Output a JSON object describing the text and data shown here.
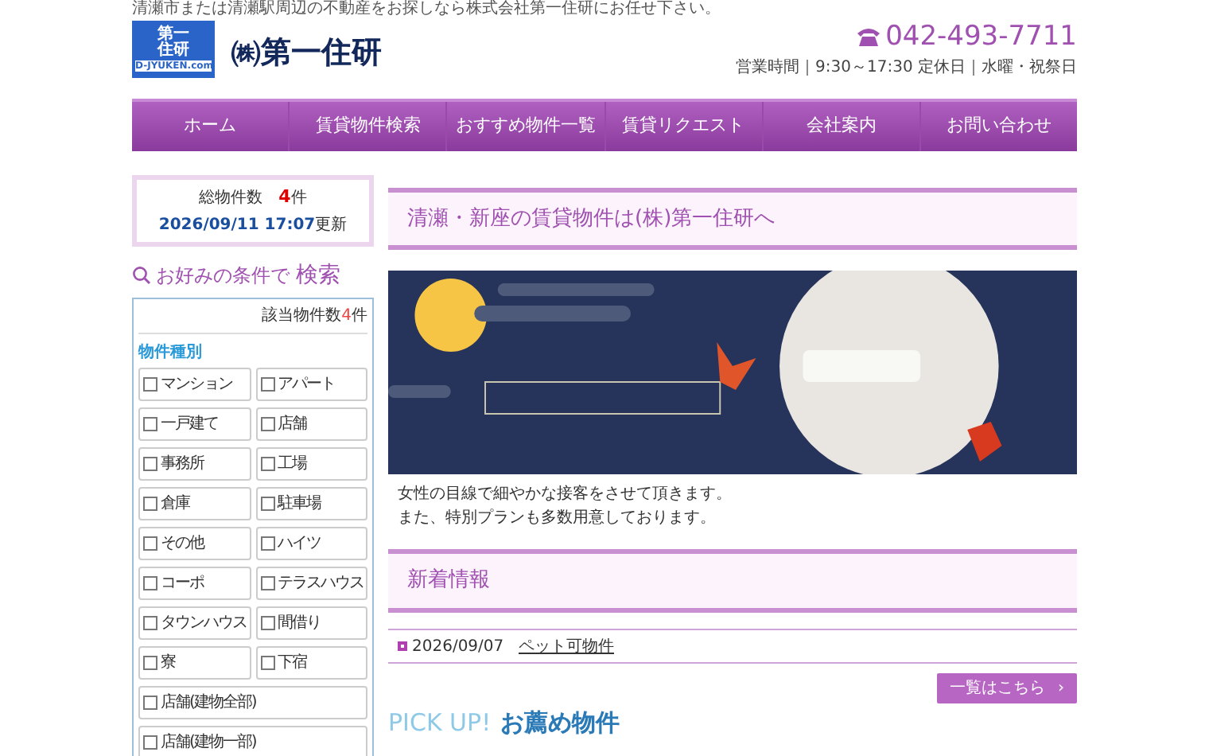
{
  "tagline": "清瀬市または清瀬駅周辺の不動産をお探しなら株式会社第一住研にお任せ下さい。",
  "logo": {
    "mark_line1": "第一",
    "mark_line2": "住研",
    "mark_url": "D-JYUKEN.com",
    "name": "㈱第一住研"
  },
  "contact": {
    "phone": "042-493-7711",
    "hours": "営業時間｜9:30～17:30 定休日｜水曜・祝祭日"
  },
  "nav": [
    {
      "label": "ホーム",
      "selected": false
    },
    {
      "label": "賃貸物件検索",
      "selected": false
    },
    {
      "label": "おすすめ物件一覧",
      "selected": false
    },
    {
      "label": "賃貸リクエスト",
      "selected": false
    },
    {
      "label": "会社案内",
      "selected": false
    },
    {
      "label": "お問い合わせ",
      "selected": false
    }
  ],
  "summary": {
    "label": "総物件数",
    "count": "4",
    "unit": "件",
    "updated_date": "2026/09/11 17:07",
    "updated_suffix": "更新"
  },
  "search": {
    "title_prefix": "お好みの条件で",
    "title_main": "検索",
    "match_label": "該当物件数",
    "match_count": "4",
    "match_unit": "件",
    "group_label": "物件種別",
    "options": [
      {
        "label": "マンション",
        "checked": false,
        "kind": "half"
      },
      {
        "label": "アパート",
        "checked": false,
        "kind": "half"
      },
      {
        "label": "一戸建て",
        "checked": false,
        "kind": "half"
      },
      {
        "label": "店舗",
        "checked": false,
        "kind": "half"
      },
      {
        "label": "事務所",
        "checked": false,
        "kind": "half"
      },
      {
        "label": "工場",
        "checked": false,
        "kind": "half"
      },
      {
        "label": "倉庫",
        "checked": false,
        "kind": "half"
      },
      {
        "label": "駐車場",
        "checked": false,
        "kind": "half"
      },
      {
        "label": "その他",
        "checked": false,
        "kind": "half"
      },
      {
        "label": "ハイツ",
        "checked": false,
        "kind": "half"
      },
      {
        "label": "コーポ",
        "checked": false,
        "kind": "half"
      },
      {
        "label": "テラスハウス",
        "checked": false,
        "kind": "half"
      },
      {
        "label": "タウンハウス",
        "checked": false,
        "kind": "half"
      },
      {
        "label": "間借り",
        "checked": false,
        "kind": "half"
      },
      {
        "label": "寮",
        "checked": false,
        "kind": "half"
      },
      {
        "label": "下宿",
        "checked": false,
        "kind": "half"
      },
      {
        "label": "店舗(建物全部)",
        "checked": false,
        "kind": "full"
      },
      {
        "label": "店舗(建物一部)",
        "checked": false,
        "kind": "full"
      }
    ]
  },
  "intro": {
    "heading": "清瀬・新座の賃貸物件は(株)第一住研へ",
    "lines": [
      "女性の目線で細やかな接客をさせて頂きます。",
      "また、特別プランも多数用意しております。"
    ]
  },
  "news": {
    "heading": "新着情報",
    "items": [
      {
        "date": "2026/09/07",
        "title": "ペット可物件"
      }
    ],
    "more_button": "一覧はこちら",
    "more_arrow": "›"
  },
  "pickup": {
    "prefix": "PICK UP!",
    "title": "お薦め物件"
  }
}
